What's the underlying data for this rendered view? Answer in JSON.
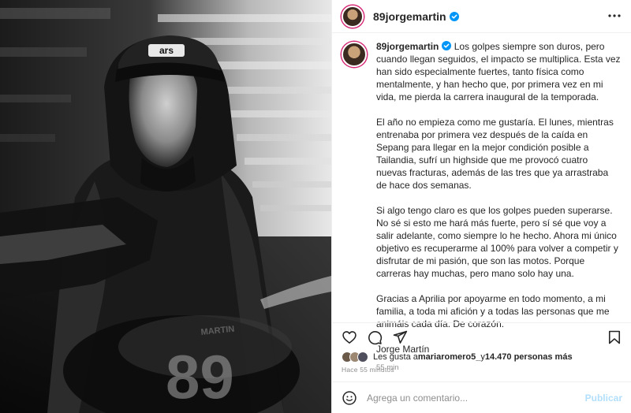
{
  "post": {
    "username": "89jorgemartin",
    "caption_paragraphs": [
      "Los golpes siempre son duros, pero cuando llegan seguidos, el impacto se multiplica. Esta vez han sido especialmente fuertes, tanto física como mentalmente, y han hecho que, por primera vez en mi vida, me pierda la carrera inaugural de la temporada.",
      "El año no empieza como me gustaría. El lunes, mientras entrenaba por primera vez después de la caída en Sepang para llegar en la mejor condición posible a Tailandia, sufrí un highside que me provocó cuatro nuevas fracturas, además de las tres que ya arrastraba de hace dos semanas.",
      "Si algo tengo claro es que los golpes pueden superarse. No sé si esto me hará más fuerte, pero sí sé que voy a salir adelante, como siempre lo he hecho. Ahora mi único objetivo es recuperarme al 100% para volver a competir y disfrutar de mi pasión, que son las motos. Porque carreras hay muchas, pero mano solo hay una.",
      "Gracias a Aprilia por apoyarme en todo momento, a mi familia, a toda mi afición y a todas las personas que me animáis cada día. De corazón.",
      "Jorge Martín"
    ],
    "caption_time": "55 min",
    "likes_prefix": "Les gusta a ",
    "likes_user": "mariaromero5_",
    "likes_middle": " y ",
    "likes_count": "14.470 personas más",
    "posted_ago": "Hace 55 minutos",
    "comment_placeholder": "Agrega un comentario...",
    "post_button": "Publicar",
    "photo_text": {
      "cap_logo": "ars",
      "number": "89",
      "jacket_name": "MARTIN"
    }
  },
  "colors": {
    "verified": "#0095f6",
    "story_ring": "#d62976",
    "post_disabled": "#b2dffc",
    "muted": "#8e8e8e"
  },
  "icons": [
    "more-icon",
    "heart-icon",
    "comment-icon",
    "share-icon",
    "bookmark-icon",
    "emoji-icon",
    "verified-icon"
  ]
}
